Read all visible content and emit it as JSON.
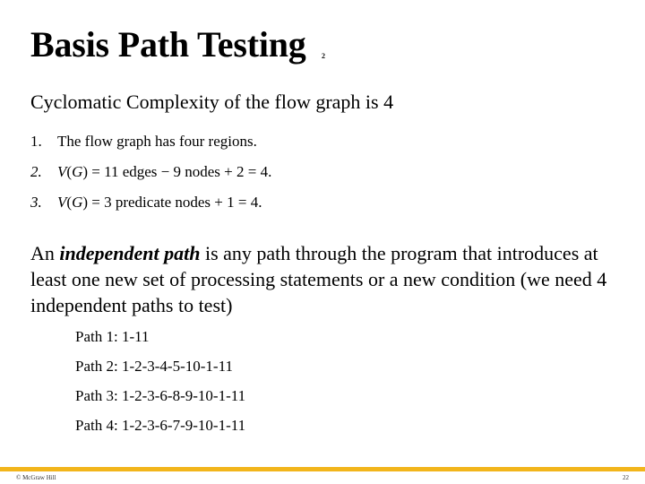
{
  "slide": {
    "title": "Basis Path Testing",
    "title_superscript": "2",
    "heading": "Cyclomatic Complexity of the flow graph is 4",
    "list": [
      {
        "num": "1.",
        "parts": [
          {
            "text": "The flow graph has four regions.",
            "italic": false
          }
        ]
      },
      {
        "num": "2.",
        "parts": [
          {
            "text": "V",
            "italic": true
          },
          {
            "text": "(",
            "italic": false
          },
          {
            "text": "G",
            "italic": true
          },
          {
            "text": ") = 11 edges − 9 nodes + 2 = 4.",
            "italic": false
          }
        ]
      },
      {
        "num": "3.",
        "parts": [
          {
            "text": "V",
            "italic": true
          },
          {
            "text": "(",
            "italic": false
          },
          {
            "text": "G",
            "italic": true
          },
          {
            "text": ") = 3 predicate nodes + 1 = 4.",
            "italic": false
          }
        ]
      }
    ],
    "paragraph": {
      "prefix": "An ",
      "emphasis": "independent path",
      "suffix": " is any path through the program that introduces at least one new set of processing statements or a new condition (we need 4 independent paths to test)"
    },
    "paths": [
      "Path 1: 1-11",
      "Path 2: 1-2-3-4-5-10-1-11",
      "Path 3: 1-2-3-6-8-9-10-1-11",
      "Path 4: 1-2-3-6-7-9-10-1-11"
    ],
    "footer": {
      "copyright": "© McGraw Hill",
      "page_number": "22",
      "bar_color": "#f2b51b"
    }
  }
}
